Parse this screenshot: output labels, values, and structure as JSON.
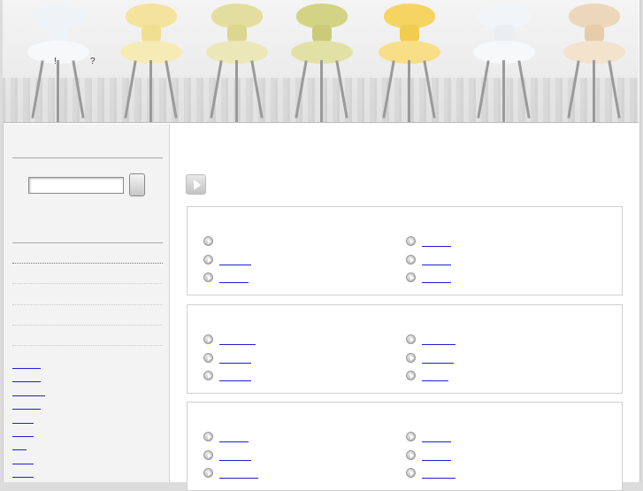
{
  "banner": {
    "tagline_left": "!",
    "tagline_right": "?",
    "chair_colors": [
      "#f2f6fa",
      "#f5e6a0",
      "#e6e0a0",
      "#d6d68a",
      "#f7d76a",
      "#f3f6f8",
      "#efd9bd"
    ]
  },
  "sidebar": {
    "search": {
      "value": "",
      "placeholder": ""
    },
    "nav_links": [
      "",
      "",
      "",
      "",
      "",
      "",
      "",
      "",
      ""
    ]
  },
  "main": {
    "panels": [
      {
        "left": [
          "",
          ""
        ],
        "right": [
          "",
          "",
          ""
        ]
      },
      {
        "left": [
          "",
          "",
          ""
        ],
        "right": [
          "",
          "",
          ""
        ]
      },
      {
        "left": [
          "",
          "",
          ""
        ],
        "right": [
          "",
          "",
          ""
        ]
      }
    ]
  },
  "colors": {
    "link": "#1f1fd6",
    "sidebar_bg": "#f3f3f3",
    "panel_border": "#cfcfcf"
  }
}
